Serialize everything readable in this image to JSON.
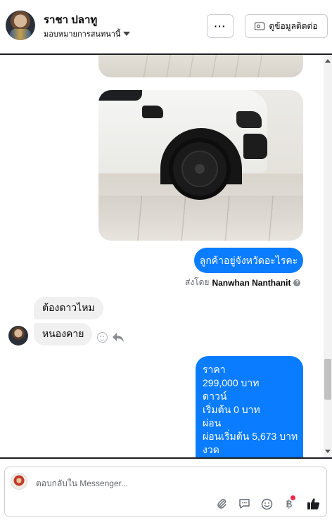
{
  "header": {
    "name": "ราชา ปลาทู",
    "assign_label": "มอบหมายการสนทนานี้",
    "more_label": "···",
    "contact_label": "ดูข้อมูลติดต่อ"
  },
  "thread": {
    "question_message": "ลูกค้าอยู่จังหวัดอะไรคะ",
    "sent_by_prefix": "ส่งโดย",
    "sent_by_name": "Nanwhan Nanthanit",
    "incoming": [
      "ต้องดาวไหม",
      "หนองคาย"
    ],
    "price_lines": [
      "ราคา",
      "299,000 บาท",
      "ดาวน์",
      "เริ่มต้น 0 บาท",
      "ผ่อน",
      "ผ่อนเริ่มต้น 5,673 บาท",
      "งวด"
    ]
  },
  "composer": {
    "placeholder": "ตอบกลับใน Messenger..."
  },
  "icons": {
    "attach": "paperclip-icon",
    "reply_template": "speech-bubble-icon",
    "emoji": "smiley-icon",
    "payment": "baht-icon",
    "like": "thumbs-up-icon"
  },
  "colors": {
    "outgoing_bubble": "#0a7cff",
    "incoming_bubble": "#f0f0f0",
    "notification_dot": "#f02849"
  }
}
